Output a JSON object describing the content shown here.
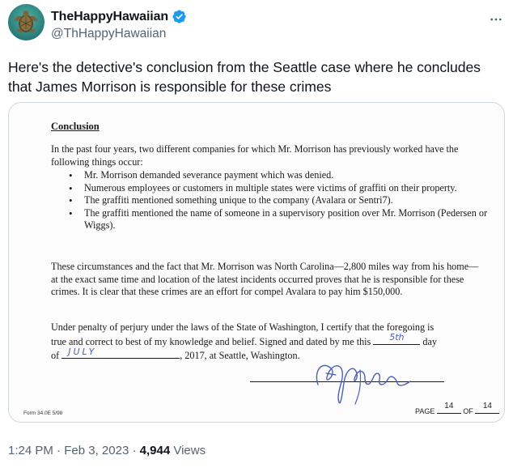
{
  "author": {
    "display_name": "TheHappyHawaiian",
    "handle": "@ThHappyHawaiian",
    "verified": true,
    "avatar_icon": "sea-turtle-avatar"
  },
  "tweet": {
    "text": "Here's the detective's conclusion from the Seattle case where he concludes that James Morrison is responsible for these crimes"
  },
  "document": {
    "heading": "Conclusion",
    "intro": "In the past four years, two different companies for which Mr. Morrison has previously worked have the following things occur:",
    "bullets": [
      "Mr. Morrison demanded severance payment which was denied.",
      "Numerous employees or customers in multiple states were victims of graffiti on their property.",
      "The graffiti mentioned something unique to the company (Avalara or Sentri7).",
      "The graffiti mentioned the name of someone in a supervisory position over Mr. Morrison (Pedersen or Wiggs)."
    ],
    "paragraph2": "These circumstances and the fact that Mr. Morrison was North Carolina—2,800 miles way from his home—at the exact same time and location of the latest incidents occurred proves that he is responsible for these crimes. It is clear that these crimes are an effort for compel Avalara to pay him $150,000.",
    "certify_line1": "Under penalty of perjury under the laws of the State of Washington, I certify that the foregoing is",
    "certify_line2_pre": "true and correct to best of my knowledge and belief.  Signed and dated by me this",
    "day_value": "5th",
    "certify_line2_post": "day",
    "of_label": "of",
    "month_value": "JULY",
    "certify_line3_post": ", 2017, at Seattle, Washington.",
    "form_id": "Form 34.0E   5/98",
    "page_label": "PAGE",
    "page_number": "14",
    "of_pages_label": "OF",
    "total_pages": "14"
  },
  "meta": {
    "time": "1:24 PM",
    "separator1": " · ",
    "date": "Feb 3, 2023",
    "separator2": " · ",
    "views_count": "4,944",
    "views_label": " Views"
  },
  "colors": {
    "verified": "#1d9bf0",
    "handwriting": "#4a5fb5",
    "secondary_text": "#536471"
  }
}
